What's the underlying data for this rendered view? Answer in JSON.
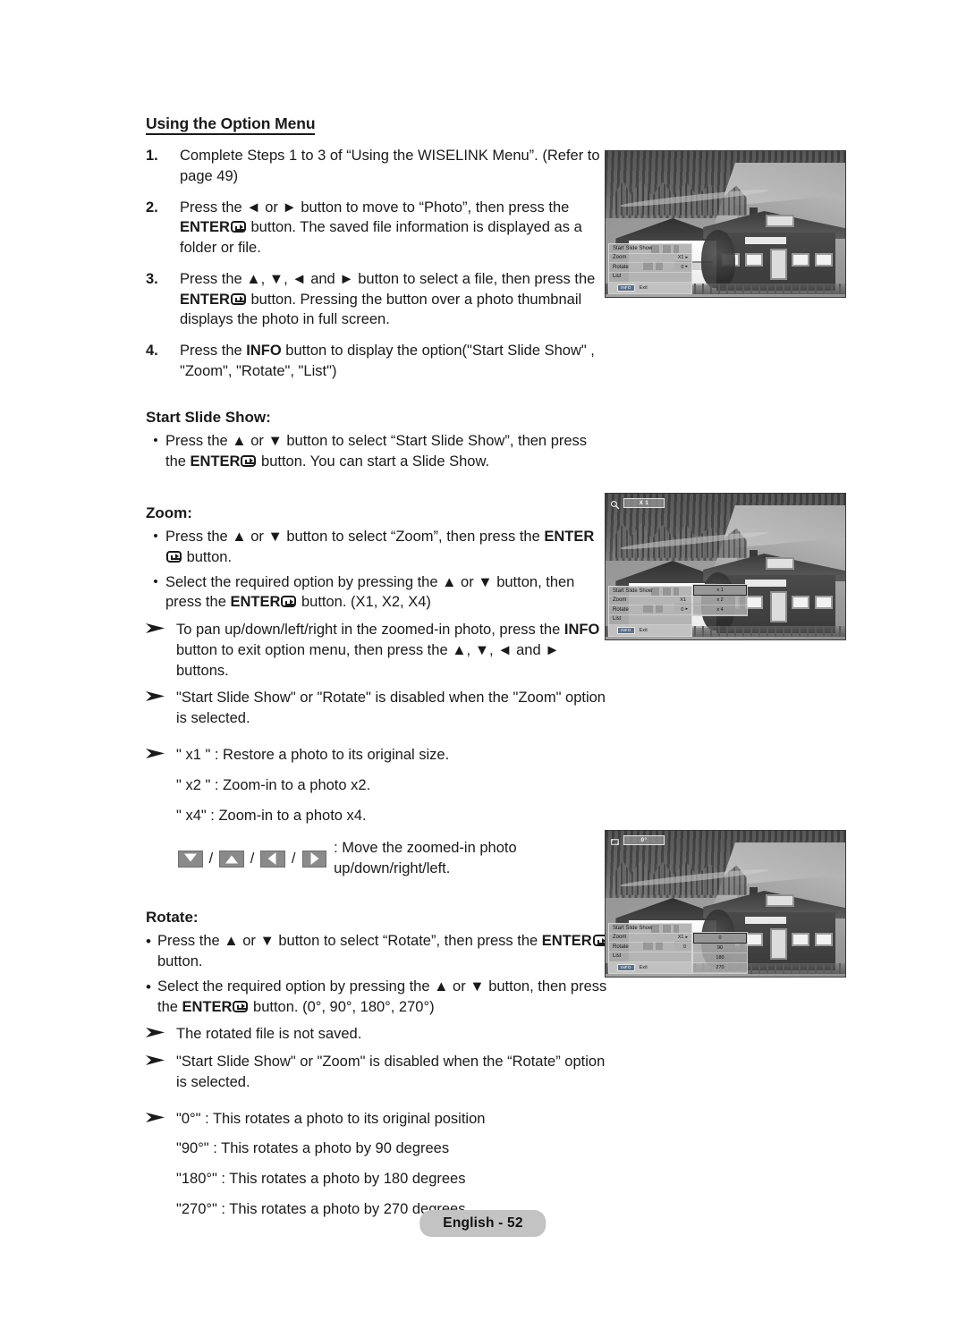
{
  "page": {
    "heading": "Using the Option Menu",
    "footer_badge": "English - 52"
  },
  "steps": [
    {
      "num": "1.",
      "text": "Complete Steps 1 to 3 of “Using the WISELINK Menu”. (Refer to page 49)"
    },
    {
      "num": "2.",
      "text_a": "Press the ◄ or ► button to move to “Photo”, then press the ",
      "bold_a": "ENTER",
      "text_b": " button. The saved file information is displayed as a folder or file."
    },
    {
      "num": "3.",
      "text_a": "Press the ▲, ▼, ◄ and ► button to select a file, then press the ",
      "bold_a": "ENTER",
      "text_b": " button. Pressing the button over a photo thumbnail displays the photo in full screen."
    },
    {
      "num": "4.",
      "text_a": "Press the ",
      "bold_a": "INFO",
      "text_b": " button to display the option(\"Start Slide Show\" , \"Zoom\", \"Rotate\", \"List\")"
    }
  ],
  "slideshow": {
    "heading": "Start Slide Show:",
    "bullet_a": "Press the ▲ or ▼ button to select “Start Slide Show”, then press the ",
    "bullet_bold": "ENTER",
    "bullet_b": " button. You can start a Slide Show."
  },
  "zoom": {
    "heading": "Zoom:",
    "b1_a": "Press the ▲ or ▼ button to select “Zoom”, then press the ",
    "b1_bold": "ENTER",
    "b1_b": " button.",
    "b2_a": "Select the required option by pressing the ▲ or ▼ button, then press the ",
    "b2_bold": "ENTER",
    "b2_b": " button. (X1, X2, X4)",
    "note1_a": "To pan up/down/left/right in the zoomed-in photo, press the ",
    "note1_bold": "INFO",
    "note1_b": " button to exit option menu, then press the ▲, ▼, ◄ and ► buttons.",
    "note2": "\"Start Slide Show\" or \"Rotate\" is disabled when the \"Zoom\" option is selected.",
    "x1_line": "\" x1 \" :  Restore a photo to its original size.",
    "x2_line": "\" x2 \" : Zoom-in to a photo x2.",
    "x4_line": "\" x4\"  : Zoom-in to a photo x4.",
    "keys_caption": ": Move the zoomed-in photo up/down/right/left.",
    "key_down": "down-arrow",
    "key_up": "up-arrow",
    "key_left": "left-arrow",
    "key_right": "right-arrow",
    "separator": "/"
  },
  "rotate": {
    "heading": "Rotate:",
    "b1_a": "Press the ▲ or ▼ button to select “Rotate”, then press the ",
    "b1_bold": "ENTER",
    "b1_b": " button.",
    "b2_a": "Select the required option by pressing the ▲ or ▼ button, then press the ",
    "b2_bold": "ENTER",
    "b2_b": " button. (0°, 90°, 180°, 270°)",
    "note1": "The rotated file is not saved.",
    "note2": "\"Start Slide Show\" or \"Zoom\" is disabled when the “Rotate” option is selected.",
    "r0_line": "\"0°\" : This rotates a photo to its original position",
    "r90_line": "\"90°\" : This rotates a photo by 90 degrees",
    "r180_line": "\"180°\" :  This rotates a photo by 180 degrees",
    "r270_line": "\"270°\" : This rotates a photo by 270 degrees"
  },
  "tv_screens": [
    {
      "id": "tv1",
      "badge": null,
      "menu": {
        "item1": "Start Slide Show",
        "item2_label": "Zoom",
        "item2_value": "X1",
        "item2_caret": "▸",
        "item3_label": "Rotate",
        "item3_value": "0",
        "item3_caret": "▸",
        "item4": "List",
        "foot_key": "INFO",
        "foot_label": "Exit"
      },
      "submenu": null
    },
    {
      "id": "tv2",
      "badge": {
        "icon": "magnifier-icon",
        "text": "X 1"
      },
      "menu": {
        "item1": "Start Slide Show",
        "item2_label": "Zoom",
        "item2_value": "X1",
        "item2_caret": "",
        "item3_label": "Rotate",
        "item3_value": "0",
        "item3_caret": "▸",
        "item4": "List",
        "foot_key": "INFO",
        "foot_label": "Exit"
      },
      "submenu": {
        "title": "zoom-options",
        "options": [
          "x 1",
          "x 2",
          "x 4"
        ],
        "selected": 0
      }
    },
    {
      "id": "tv3",
      "badge": {
        "icon": "rotate-icon",
        "text": "0°"
      },
      "menu": {
        "item1": "Start Slide Show",
        "item2_label": "Zoom",
        "item2_value": "X1",
        "item2_caret": "▸",
        "item3_label": "Rotate",
        "item3_value": "0",
        "item3_caret": "",
        "item4": "List",
        "foot_key": "INFO",
        "foot_label": "Exit"
      },
      "submenu": {
        "title": "rotate-options",
        "options": [
          "0",
          "90",
          "180",
          "270"
        ],
        "selected": 0
      }
    }
  ]
}
